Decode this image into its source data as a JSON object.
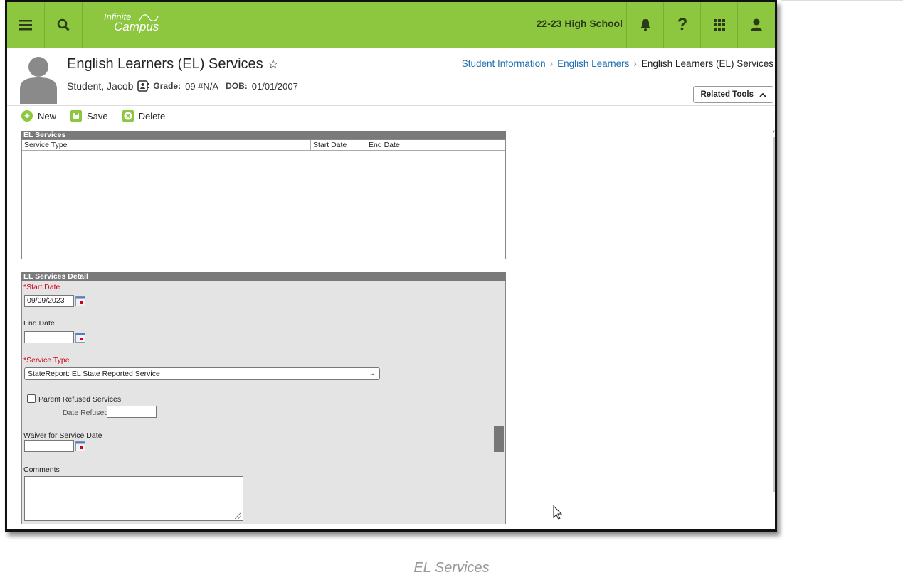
{
  "topbar": {
    "logo_line1": "Infinite",
    "logo_line2": "Campus",
    "school": "22-23 High School"
  },
  "header": {
    "page_title": "English Learners (EL) Services",
    "student_name": "Student, Jacob",
    "grade_label": "Grade:",
    "grade_value": "09 #N/A",
    "dob_label": "DOB:",
    "dob_value": "01/01/2007",
    "breadcrumb": [
      "Student Information",
      "English Learners",
      "English Learners (EL) Services"
    ],
    "related_tools": "Related Tools"
  },
  "toolbar": {
    "new_label": "New",
    "save_label": "Save",
    "delete_label": "Delete"
  },
  "list": {
    "title": "EL Services",
    "columns": [
      "Service Type",
      "Start Date",
      "End Date"
    ]
  },
  "detail": {
    "title": "EL Services Detail",
    "start_date_label": "*Start Date",
    "start_date_value": "09/09/2023",
    "end_date_label": "End Date",
    "end_date_value": "",
    "service_type_label": "*Service Type",
    "service_type_value": "StateReport: EL State Reported Service",
    "parent_refused_label": "Parent Refused Services",
    "parent_refused_checked": false,
    "date_refused_label": "Date Refused:",
    "date_refused_value": "",
    "waiver_label": "Waiver for Service Date",
    "waiver_value": "",
    "comments_label": "Comments",
    "comments_value": ""
  },
  "caption": "EL Services",
  "colors": {
    "brand_green": "#8dc63f",
    "link_blue": "#1f6fb2",
    "required_red": "#d0021b"
  }
}
